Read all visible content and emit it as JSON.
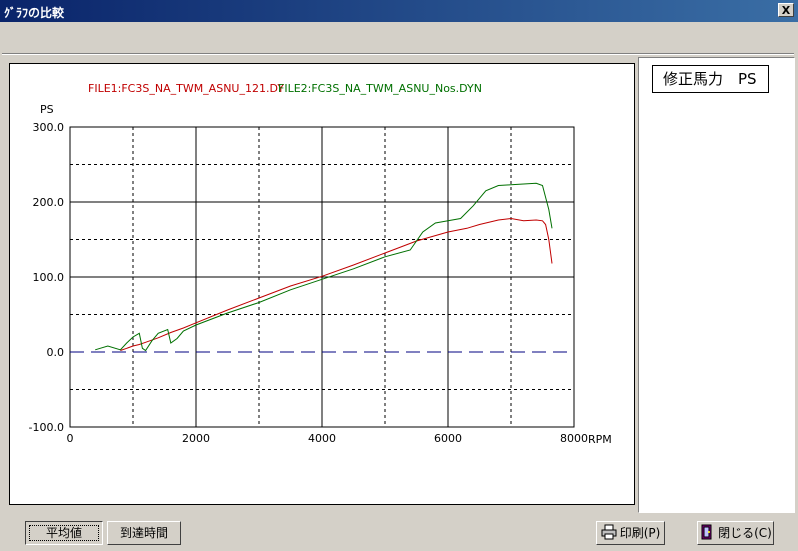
{
  "window": {
    "title": "ｸﾞﾗﾌの比較",
    "close_label": "X"
  },
  "side": {
    "metric_label": "修正馬力　PS"
  },
  "buttons": {
    "average": "平均値",
    "arrival_time": "到達時間",
    "print": "印刷(P)",
    "close": "閉じる(C)"
  },
  "colors": {
    "file1": "#c00000",
    "file2": "#007000",
    "zero_line": "#000080"
  },
  "chart_data": {
    "type": "line",
    "title": "",
    "legend": "top",
    "xlabel": "RPM",
    "ylabel": "PS",
    "xlim": [
      0,
      8000
    ],
    "ylim": [
      -100,
      300
    ],
    "x_ticks": [
      0,
      2000,
      4000,
      6000,
      8000
    ],
    "x_tick_labels": [
      "0",
      "2000",
      "4000",
      "6000",
      "8000"
    ],
    "y_ticks": [
      -100,
      0,
      100,
      200,
      300
    ],
    "y_tick_labels": [
      "-100.0",
      "0.0",
      "100.0",
      "200.0",
      "300.0"
    ],
    "grid": true,
    "reference_line": 0,
    "series": [
      {
        "name": "FILE1:FC3S_NA_TWM_ASNU_121.DYN",
        "legend_label": "FILE1:FC3S_NA_TWM_ASNU_121.DY",
        "color": "#c00000",
        "x": [
          800,
          900,
          1000,
          1100,
          1200,
          1400,
          1600,
          1800,
          2000,
          2500,
          3000,
          3500,
          4000,
          4500,
          5000,
          5500,
          6000,
          6300,
          6500,
          6800,
          7000,
          7200,
          7400,
          7500,
          7550,
          7600,
          7650
        ],
        "y": [
          2,
          5,
          8,
          10,
          13,
          19,
          26,
          32,
          39,
          56,
          72,
          88,
          101,
          116,
          132,
          148,
          160,
          165,
          170,
          176,
          178,
          175,
          176,
          175,
          170,
          150,
          118
        ]
      },
      {
        "name": "FILE2:FC3S_NA_TWM_ASNU_Nos.DYN",
        "legend_label": "FILE2:FC3S_NA_TWM_ASNU_Nos.DYN",
        "color": "#007000",
        "x": [
          400,
          600,
          800,
          900,
          1000,
          1100,
          1150,
          1200,
          1300,
          1400,
          1550,
          1600,
          1700,
          1800,
          2000,
          2500,
          3000,
          3500,
          4000,
          4500,
          5000,
          5400,
          5600,
          5800,
          6000,
          6200,
          6400,
          6600,
          6800,
          7000,
          7200,
          7400,
          7500,
          7600,
          7650
        ],
        "y": [
          3,
          8,
          3,
          12,
          20,
          25,
          5,
          2,
          15,
          25,
          30,
          12,
          18,
          28,
          36,
          52,
          66,
          83,
          97,
          111,
          127,
          136,
          160,
          172,
          175,
          178,
          195,
          215,
          222,
          223,
          224,
          225,
          222,
          190,
          165
        ]
      }
    ]
  }
}
